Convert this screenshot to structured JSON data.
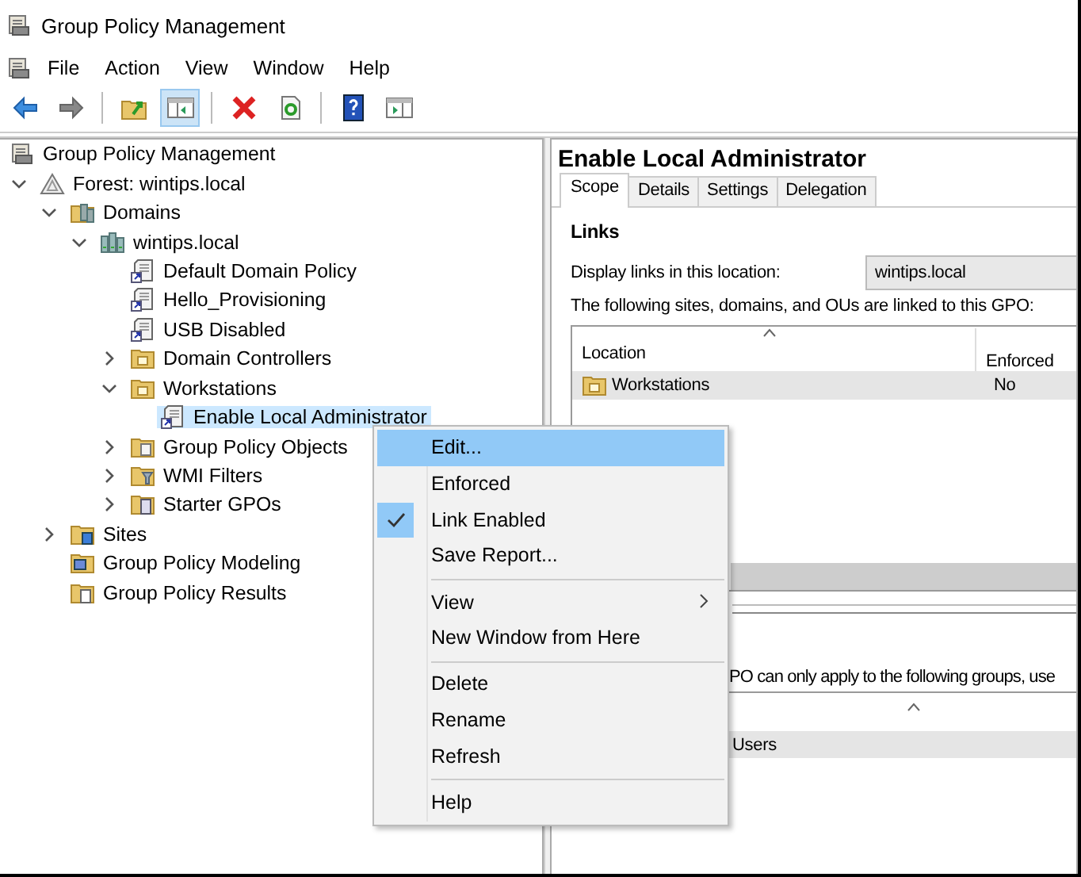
{
  "window": {
    "title": "Group Policy Management"
  },
  "menu_bar": [
    "File",
    "Action",
    "View",
    "Window",
    "Help"
  ],
  "toolbar": [
    {
      "kind": "back",
      "pressed": false
    },
    {
      "kind": "forward",
      "pressed": false
    },
    {
      "kind": "separator"
    },
    {
      "kind": "up",
      "pressed": false
    },
    {
      "kind": "tree-pane",
      "pressed": true
    },
    {
      "kind": "separator"
    },
    {
      "kind": "delete",
      "pressed": false
    },
    {
      "kind": "refresh",
      "pressed": false
    },
    {
      "kind": "separator"
    },
    {
      "kind": "help",
      "pressed": false
    },
    {
      "kind": "action-pane",
      "pressed": false
    }
  ],
  "tree": [
    {
      "label": "Group Policy Management",
      "kind": "root",
      "selected": false,
      "children": [
        {
          "label": "Forest: wintips.local",
          "kind": "forest",
          "expanded": true,
          "selected": false,
          "children": [
            {
              "label": "Domains",
              "kind": "domains",
              "expanded": true,
              "selected": false,
              "children": [
                {
                  "label": "wintips.local",
                  "kind": "domain",
                  "expanded": true,
                  "selected": false,
                  "children": [
                    {
                      "label": "Default Domain Policy",
                      "kind": "gpo-link",
                      "selected": false
                    },
                    {
                      "label": "Hello_Provisioning",
                      "kind": "gpo-link",
                      "selected": false
                    },
                    {
                      "label": "USB Disabled",
                      "kind": "gpo-link",
                      "selected": false
                    },
                    {
                      "label": "Domain Controllers",
                      "kind": "ou",
                      "expanded": false,
                      "selected": false
                    },
                    {
                      "label": "Workstations",
                      "kind": "ou",
                      "expanded": true,
                      "selected": false,
                      "children": [
                        {
                          "label": "Enable Local Administrator",
                          "kind": "gpo-link",
                          "selected": true
                        }
                      ]
                    },
                    {
                      "label": "Group Policy Objects",
                      "kind": "gpo-folder",
                      "expanded": false,
                      "selected": false
                    },
                    {
                      "label": "WMI Filters",
                      "kind": "wmi",
                      "expanded": false,
                      "selected": false
                    },
                    {
                      "label": "Starter GPOs",
                      "kind": "starter",
                      "expanded": false,
                      "selected": false
                    }
                  ]
                }
              ]
            },
            {
              "label": "Sites",
              "kind": "sites",
              "expanded": false,
              "selected": false
            },
            {
              "label": "Group Policy Modeling",
              "kind": "modeling",
              "selected": false
            },
            {
              "label": "Group Policy Results",
              "kind": "results",
              "selected": false
            }
          ]
        }
      ]
    }
  ],
  "details": {
    "title": "Enable Local Administrator",
    "tabs": [
      {
        "label": "Scope",
        "selected": true
      },
      {
        "label": "Details",
        "selected": false
      },
      {
        "label": "Settings",
        "selected": false
      },
      {
        "label": "Delegation",
        "selected": false
      }
    ],
    "links": {
      "heading": "Links",
      "location_label": "Display links in this location:",
      "location_value": "wintips.local",
      "description": "The following sites, domains, and OUs are linked to this GPO:",
      "columns": [
        "Location",
        "Enforced"
      ],
      "rows": [
        {
          "cells": [
            "Workstations",
            "No"
          ],
          "selected": true
        }
      ]
    },
    "security_filtering": {
      "description": "PO can only apply to the following groups, use",
      "rows": [
        {
          "name": "Users",
          "selected": true
        }
      ]
    }
  },
  "context_menu": [
    {
      "kind": "item",
      "label": "Edit...",
      "selected": true,
      "checked": false,
      "submenu": false
    },
    {
      "kind": "item",
      "label": "Enforced",
      "selected": false,
      "checked": false,
      "submenu": false
    },
    {
      "kind": "item",
      "label": "Link Enabled",
      "selected": false,
      "checked": true,
      "submenu": false
    },
    {
      "kind": "item",
      "label": "Save Report...",
      "selected": false,
      "checked": false,
      "submenu": false
    },
    {
      "kind": "separator"
    },
    {
      "kind": "item",
      "label": "View",
      "selected": false,
      "checked": false,
      "submenu": true
    },
    {
      "kind": "item",
      "label": "New Window from Here",
      "selected": false,
      "checked": false,
      "submenu": false
    },
    {
      "kind": "separator"
    },
    {
      "kind": "item",
      "label": "Delete",
      "selected": false,
      "checked": false,
      "submenu": false
    },
    {
      "kind": "item",
      "label": "Rename",
      "selected": false,
      "checked": false,
      "submenu": false
    },
    {
      "kind": "item",
      "label": "Refresh",
      "selected": false,
      "checked": false,
      "submenu": false
    },
    {
      "kind": "separator"
    },
    {
      "kind": "item",
      "label": "Help",
      "selected": false,
      "checked": false,
      "submenu": false
    }
  ]
}
